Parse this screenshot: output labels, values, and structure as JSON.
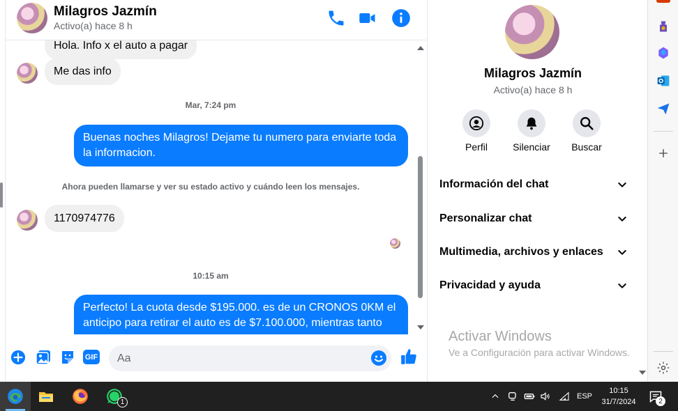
{
  "header": {
    "name": "Milagros Jazmín",
    "status": "Activo(a) hace 8 h"
  },
  "messages": {
    "partial_top": "Hola. Info x el auto a pagar",
    "in1": "Me das info",
    "sep1": "Mar, 7:24 pm",
    "out1": "Buenas noches Milagros! Dejame tu numero para enviarte toda la informacion.",
    "system": "Ahora pueden llamarse y ver su estado activo y cuándo leen los mensajes.",
    "in2": "1170974776",
    "sep2": "10:15 am",
    "out2": "Perfecto! La cuota desde $195.000. es de un CRONOS 0KM el anticipo para retirar el auto es de $7.100.000, mientras tanto"
  },
  "composer": {
    "placeholder": "Aa",
    "gif_label": "GIF"
  },
  "panel": {
    "name": "Milagros Jazmín",
    "status": "Activo(a) hace 8 h",
    "actions": [
      "Perfil",
      "Silenciar",
      "Buscar"
    ],
    "sections": [
      "Información del chat",
      "Personalizar chat",
      "Multimedia, archivos y enlaces",
      "Privacidad y ayuda"
    ]
  },
  "watermark": {
    "title": "Activar Windows",
    "subtitle": "Ve a Configuración para activar Windows."
  },
  "taskbar": {
    "whatsapp_badge": "1",
    "lang": "ESP",
    "time": "10:15",
    "date": "31/7/2024",
    "notif_count": "2"
  },
  "colors": {
    "accent": "#0a7cff",
    "bubble_in": "#f0f0f0",
    "taskbar": "#202020"
  }
}
